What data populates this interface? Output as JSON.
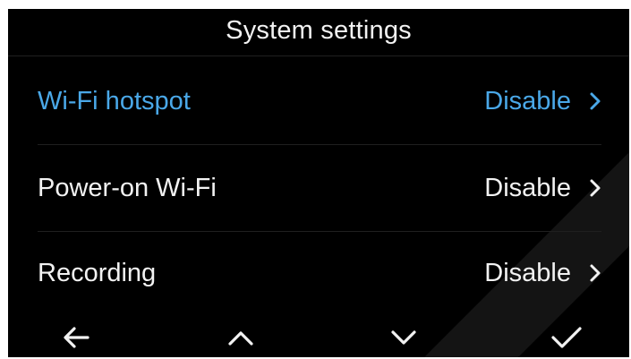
{
  "header": {
    "title": "System settings"
  },
  "settings": {
    "items": [
      {
        "label": "Wi-Fi hotspot",
        "value": "Disable",
        "selected": true
      },
      {
        "label": "Power-on Wi-Fi",
        "value": "Disable",
        "selected": false
      },
      {
        "label": "Recording",
        "value": "Disable",
        "selected": false
      }
    ]
  },
  "navbar": {
    "icons": [
      "arrow-left-icon",
      "chevron-up-icon",
      "chevron-down-icon",
      "checkmark-icon"
    ]
  },
  "colors": {
    "background": "#000000",
    "text": "#f2f2f2",
    "accent": "#4aa8e8",
    "divider": "#1f1f1f"
  }
}
